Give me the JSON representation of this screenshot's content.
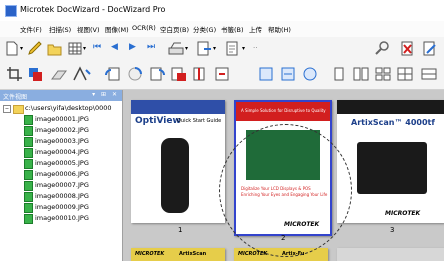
{
  "window": {
    "title": "Microtek DocWizard - DocWizard Pro"
  },
  "menu": [
    {
      "label": "文件(F)"
    },
    {
      "label": "扫描(S)"
    },
    {
      "label": "视图(V)"
    },
    {
      "label": "图像(M)"
    },
    {
      "label": "OCR(R)"
    },
    {
      "label": "空白页(B)"
    },
    {
      "label": "分类(G)"
    },
    {
      "label": "书籤(B)"
    },
    {
      "label": "上传"
    },
    {
      "label": "帮助(H)"
    }
  ],
  "toolbar": {
    "document_combo_value": "test1"
  },
  "sidebar": {
    "title": "文件视图",
    "panel_buttons": "▾ ⊞ ✕",
    "root_path": "c:\\users\\yifa\\desktop\\0000",
    "files": [
      {
        "name": "image00001.JPG"
      },
      {
        "name": "image00002.JPG"
      },
      {
        "name": "image00003.JPG"
      },
      {
        "name": "image00004.JPG"
      },
      {
        "name": "image00005.JPG"
      },
      {
        "name": "image00006.JPG"
      },
      {
        "name": "image00007.JPG"
      },
      {
        "name": "image00008.JPG"
      },
      {
        "name": "image00009.JPG"
      },
      {
        "name": "image00010.JPG"
      }
    ]
  },
  "pages": [
    {
      "number": "1",
      "heading": "OptiView",
      "subheading": "Quick Start Guide"
    },
    {
      "number": "2",
      "heading": "A Simple Solution for Disruptive to Quality",
      "caption": "Digitalize Your LCD Displays & POS",
      "caption2": "Enriching Your Eyes and Engaging Your Life",
      "brand": "MICROTEK"
    },
    {
      "number": "3",
      "heading": "ArtixScan™ 4000tf",
      "brand": "MICROTEK"
    },
    {
      "brand": "MICROTEK",
      "heading": "ArtixScan"
    },
    {
      "brand": "MICROTEK",
      "heading": "Artix-Fu"
    }
  ],
  "colors": {
    "selection": "#3344cc",
    "viewer_bg": "#c9c9c9",
    "sidebar_header": "#8aaee0"
  }
}
